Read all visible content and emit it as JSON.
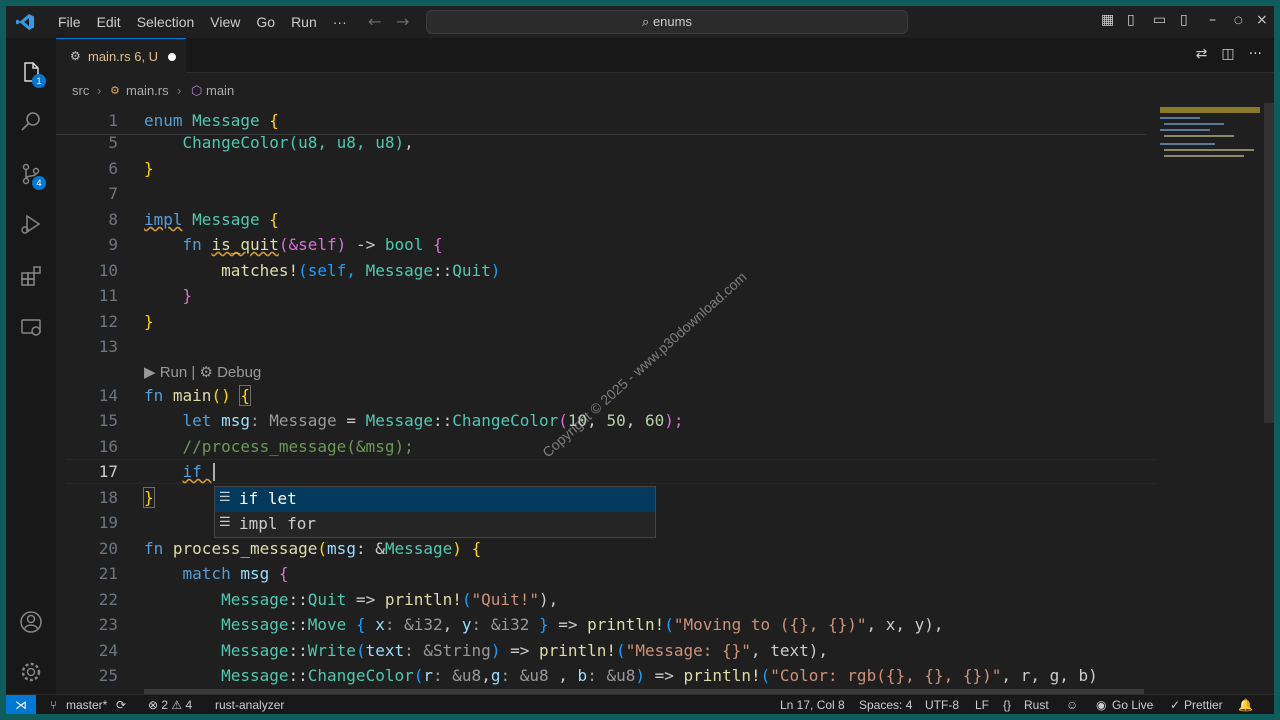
{
  "titlebar": {
    "menu": [
      "File",
      "Edit",
      "Selection",
      "View",
      "Go",
      "Run",
      "···"
    ],
    "search": "enums"
  },
  "activity": {
    "explorer_badge": "1",
    "scm_badge": "4"
  },
  "tab": {
    "name": "main.rs 6, U"
  },
  "breadcrumb": [
    "src",
    "main.rs",
    "main"
  ],
  "line_numbers": [
    "1",
    "5",
    "6",
    "7",
    "8",
    "9",
    "10",
    "11",
    "12",
    "13",
    "14",
    "15",
    "16",
    "17",
    "18",
    "19",
    "20",
    "21",
    "22",
    "23",
    "24",
    "25"
  ],
  "code": {
    "l1_kw": "enum",
    "l1_ty": "Message",
    "l1_br": "{",
    "l5_ty": "ChangeColor",
    "l5_args": "(u8, u8, u8)",
    "l5_end": ",",
    "l6": "}",
    "l8_kw": "impl",
    "l8_ty": "Message",
    "l8_br": "{",
    "l9_kw": "fn",
    "l9_fn": "is_quit",
    "l9_args": "(&self)",
    "l9_arrow": " -> ",
    "l9_ret": "bool",
    "l9_br": "{",
    "l10_fn": "matches!",
    "l10_a": "(self, ",
    "l10_ty": "Message",
    "l10_sep": "::",
    "l10_q": "Quit",
    "l10_end": ")",
    "l11": "}",
    "l12": "}",
    "codelens": "▶ Run | ⚙ Debug",
    "l14_kw": "fn",
    "l14_fn": "main",
    "l14_p": "()",
    "l14_br": "{",
    "l15_kw": "let",
    "l15_var": "msg",
    "l15_hint": ": Message",
    "l15_eq": " = ",
    "l15_ty": "Message",
    "l15_sep": "::",
    "l15_fn": "ChangeColor",
    "l15_o": "(",
    "l15_n1": "10",
    "l15_c1": ", ",
    "l15_n2": "50",
    "l15_c2": ", ",
    "l15_n3": "60",
    "l15_e": ");",
    "l16": "//process_message(&msg);",
    "l17": "if ",
    "l18": "}",
    "l20_kw": "fn",
    "l20_fn": "process_message",
    "l20_o": "(",
    "l20_var": "msg",
    "l20_c": ": &",
    "l20_ty": "Message",
    "l20_e": ")",
    "l20_br": "{",
    "l21_kw": "match",
    "l21_var": "msg",
    "l21_br": "{",
    "l22_ty": "Message",
    "l22_sep": "::",
    "l22_v": "Quit",
    "l22_ar": " => ",
    "l22_fn": "println!",
    "l22_o": "(",
    "l22_s": "\"Quit!\"",
    "l22_e": "),",
    "l23_ty": "Message",
    "l23_sep": "::",
    "l23_v": "Move",
    "l23_o": " { ",
    "l23_x": "x",
    "l23_xh": ": &i32",
    "l23_c": ", ",
    "l23_y": "y",
    "l23_yh": ": &i32",
    "l23_cl": " }",
    "l23_ar": " => ",
    "l23_fn": "println!",
    "l23_po": "(",
    "l23_s": "\"Moving to ({}, {})\"",
    "l23_rest": ", x, y),",
    "l24_ty": "Message",
    "l24_sep": "::",
    "l24_v": "Write",
    "l24_o": "(",
    "l24_t": "text",
    "l24_th": ": &String",
    "l24_c": ")",
    "l24_ar": " => ",
    "l24_fn": "println!",
    "l24_po": "(",
    "l24_s": "\"Message: {}\"",
    "l24_rest": ", text),",
    "l25_ty": "Message",
    "l25_sep": "::",
    "l25_v": "ChangeColor",
    "l25_o": "(",
    "l25_r": "r",
    "l25_rh": ": &u8",
    "l25_c1": ",",
    "l25_g": "g",
    "l25_gh": ": &u8",
    "l25_c2": " , ",
    "l25_b": "b",
    "l25_bh": ": &u8",
    "l25_c": ")",
    "l25_ar": " => ",
    "l25_fn": "println!",
    "l25_po": "(",
    "l25_s": "\"Color: rgb({}, {}, {})\"",
    "l25_rest": ", r, g, b)"
  },
  "suggest": [
    "if let",
    "impl for"
  ],
  "watermark": "Copyright © 2025 - www.p30download.com",
  "status": {
    "branch": "master*",
    "problems": "⊗ 2 ⚠ 4",
    "analyzer": "rust-analyzer",
    "position": "Ln 17, Col 8",
    "spaces": "Spaces: 4",
    "encoding": "UTF-8",
    "eol": "LF",
    "language": "Rust",
    "golive": "Go Live",
    "prettier": "Prettier"
  },
  "colors": {
    "accent": "#0078d4",
    "background": "#1f1f1f",
    "keyword": "#569cd6",
    "type": "#4ec9b0",
    "function": "#dcdcaa",
    "string": "#ce9178",
    "comment": "#6a9955"
  }
}
